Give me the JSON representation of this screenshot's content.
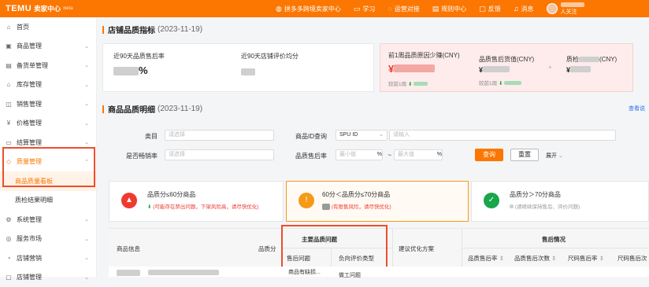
{
  "topbar": {
    "logo": "TEMU",
    "subtitle": "卖家中心",
    "beta": "Beta",
    "nav": [
      {
        "icon": "globe-icon",
        "label": "拼多多跨境卖家中心"
      },
      {
        "icon": "book-icon",
        "label": "学习"
      },
      {
        "icon": "chat-icon",
        "label": "运营对接"
      },
      {
        "icon": "rules-icon",
        "label": "规则中心"
      },
      {
        "icon": "feedback-icon",
        "label": "反馈"
      },
      {
        "icon": "bell-icon",
        "label": "消息"
      }
    ],
    "user_suffix": "人关注"
  },
  "sidebar": {
    "items": [
      {
        "icon": "home-icon",
        "label": "首页"
      },
      {
        "icon": "goods-icon",
        "label": "商品管理"
      },
      {
        "icon": "stock-icon",
        "label": "备货单管理"
      },
      {
        "icon": "warehouse-icon",
        "label": "库存管理"
      },
      {
        "icon": "sales-icon",
        "label": "销售管理"
      },
      {
        "icon": "price-icon",
        "label": "价格管理"
      },
      {
        "icon": "finance-icon",
        "label": "结算管理"
      },
      {
        "icon": "quality-icon",
        "label": "质量管理"
      },
      {
        "icon": "",
        "label": "商品质量看板"
      },
      {
        "icon": "",
        "label": "质检结果明细"
      },
      {
        "icon": "system-icon",
        "label": "系统管理"
      },
      {
        "icon": "service-icon",
        "label": "服务市场"
      },
      {
        "icon": "marketing-icon",
        "label": "店铺营销"
      },
      {
        "icon": "shop-icon",
        "label": "店铺管理"
      }
    ]
  },
  "store_quality": {
    "title": "店铺品质指标",
    "date": "(2023-11-19)",
    "after_sales_label": "近90天品质售后率",
    "after_sales_value": "%",
    "rating_label": "近90天店铺评价均分",
    "reduce_label": "前1周品质原因少赚(CNY)",
    "compare_week": "较前1周",
    "refund_label": "品质售后货值(CNY)",
    "refund_compare": "较前1周",
    "inspect_label": "质检",
    "inspect_unit": "(CNY)"
  },
  "goods_quality": {
    "title": "商品品质明细",
    "date": "(2023-11-19)",
    "link": "查看说"
  },
  "filter": {
    "category_label": "类目",
    "category_placeholder": "请选择",
    "id_query_label": "商品ID查询",
    "id_type": "SPU ID",
    "id_placeholder": "请输入",
    "bestseller_label": "是否畅销率",
    "bestseller_placeholder": "请选择",
    "rate_label": "品质售后率",
    "min_placeholder": "最小值",
    "max_placeholder": "最大值",
    "pct": "%",
    "tilde": "~",
    "query_btn": "查询",
    "reset_btn": "重置",
    "expand": "展开"
  },
  "tiers": [
    {
      "title": "品质分≤60分商品",
      "desc": "(可能存在禁出问题，下架风险高，请尽快优化)"
    },
    {
      "title": "60分＜品质分≤70分商品",
      "desc": "(有限售风险，请尽快优化)"
    },
    {
      "title": "品质分＞70分商品",
      "desc": "(请继续保持售后、评价问题)"
    }
  ],
  "table": {
    "col_goods": "商品信息",
    "col_score": "品质分",
    "col_main_issue": "主要品质问题",
    "col_after_issue": "售后问题",
    "col_review_type": "负向评价类型",
    "col_suggest": "建议优化方案",
    "col_after": "售后情况",
    "col_rate": "品质售后率",
    "col_count": "品质售后次数",
    "col_size_rate": "尺码售后率",
    "col_size_count": "尺码售后次",
    "row1_issue": "商品有缺损...",
    "row1_review": "做工问题"
  },
  "colors": {
    "brand": "#fb7701",
    "highlight": "#ee4d2d",
    "danger": "#ee3a2f",
    "warn": "#f59a16",
    "good": "#1aa54b"
  }
}
